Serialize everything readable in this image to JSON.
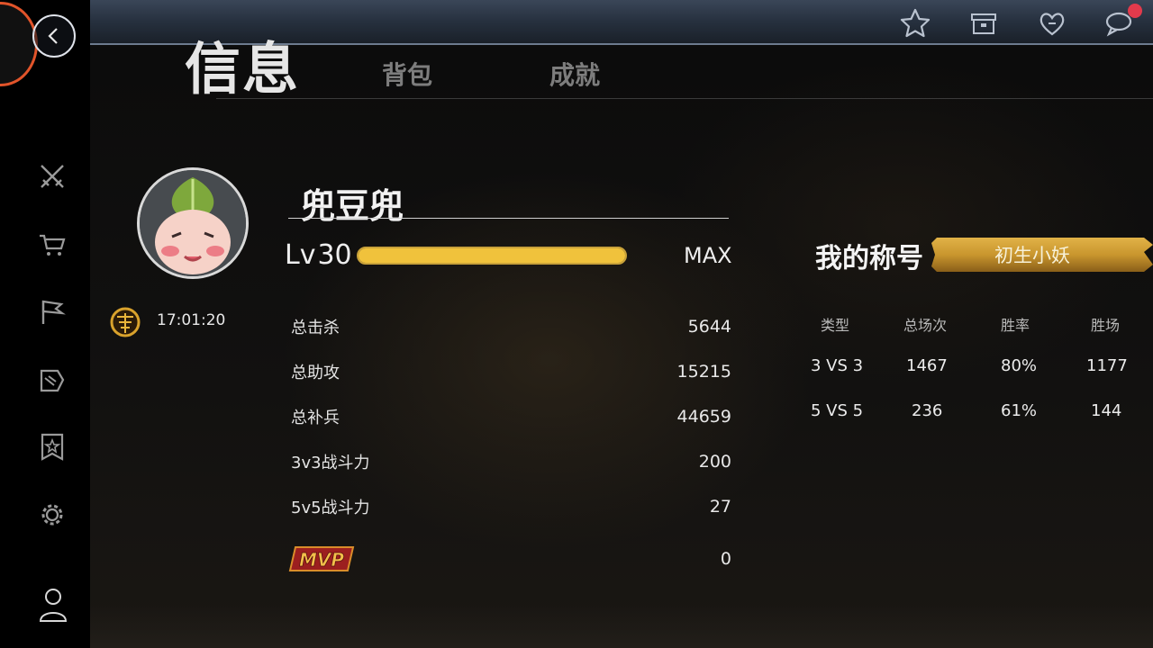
{
  "header": {
    "tab_active": "信息",
    "tabs": [
      "背包",
      "成就"
    ]
  },
  "profile": {
    "name": "兜豆兜",
    "time": "17:01:20",
    "level_label": "Lv",
    "level": "30",
    "level_max": "MAX",
    "xp_progress": 1.0
  },
  "stats": [
    {
      "label": "总击杀",
      "value": "5644"
    },
    {
      "label": "总助攻",
      "value": "15215"
    },
    {
      "label": "总补兵",
      "value": "44659"
    },
    {
      "label": "3v3战斗力",
      "value": "200"
    },
    {
      "label": "5v5战斗力",
      "value": "27"
    }
  ],
  "mvp": {
    "label": "MVP",
    "value": "0"
  },
  "title_section": {
    "label": "我的称号",
    "title": "初生小妖"
  },
  "match_table": {
    "headers": [
      "类型",
      "总场次",
      "胜率",
      "胜场"
    ],
    "rows": [
      [
        "3 VS 3",
        "1467",
        "80%",
        "1177"
      ],
      [
        "5 VS 5",
        "236",
        "61%",
        "144"
      ]
    ]
  },
  "colors": {
    "xp_fill": "#f0c23c",
    "logo": "#f05a22",
    "notification": "#e23a4c",
    "title_banner": "#c9962e"
  },
  "icons": {
    "top": [
      "star-icon",
      "archive-icon",
      "hearts-icon",
      "chat-icon"
    ],
    "sidebar": [
      "crossed-swords-icon",
      "cart-icon",
      "flag-icon",
      "scroll-icon",
      "star-badge-icon",
      "gear-icon",
      "user-icon"
    ]
  }
}
